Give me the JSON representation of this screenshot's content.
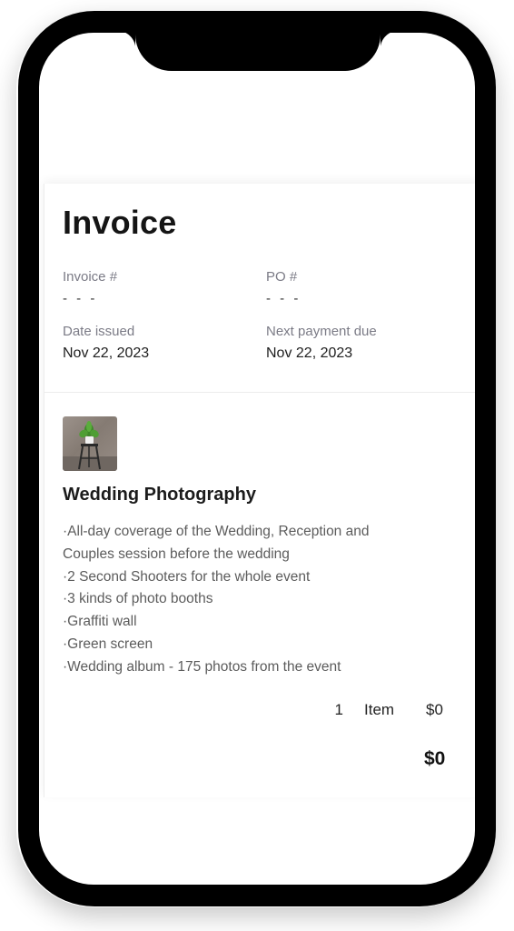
{
  "invoice": {
    "title": "Invoice",
    "invoice_number": {
      "label": "Invoice #",
      "value": "- - -"
    },
    "po_number": {
      "label": "PO #",
      "value": "- - -"
    },
    "date_issued": {
      "label": "Date issued",
      "value": "Nov 22, 2023"
    },
    "next_payment_due": {
      "label": "Next payment due",
      "value": "Nov 22, 2023"
    }
  },
  "line_item": {
    "image_icon": "plant-on-stand-photo",
    "title": "Wedding Photography",
    "description": [
      "·All-day coverage of the Wedding, Reception and",
      "Couples session before the wedding",
      "·2 Second Shooters for the whole event",
      "·3 kinds of photo booths",
      "·Graffiti wall",
      "·Green screen",
      "·Wedding album - 175 photos from the event"
    ],
    "quantity": "1",
    "unit": "Item",
    "amount": "$0"
  },
  "total": "$0",
  "colors": {
    "frame": "#000000",
    "screen": "#ffffff",
    "label": "#7b7b86",
    "text": "#1e1e1e"
  }
}
